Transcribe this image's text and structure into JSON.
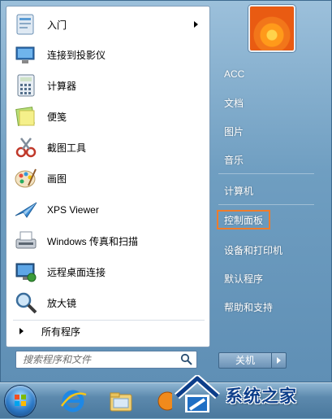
{
  "programs": [
    {
      "label": "入门",
      "icon": "getting-started-icon",
      "has_submenu": true
    },
    {
      "label": "连接到投影仪",
      "icon": "projector-icon",
      "has_submenu": false
    },
    {
      "label": "计算器",
      "icon": "calculator-icon",
      "has_submenu": false
    },
    {
      "label": "便笺",
      "icon": "sticky-notes-icon",
      "has_submenu": false
    },
    {
      "label": "截图工具",
      "icon": "snipping-tool-icon",
      "has_submenu": false
    },
    {
      "label": "画图",
      "icon": "paint-icon",
      "has_submenu": false
    },
    {
      "label": "XPS Viewer",
      "icon": "xps-viewer-icon",
      "has_submenu": false
    },
    {
      "label": "Windows 传真和扫描",
      "icon": "fax-scan-icon",
      "has_submenu": false
    },
    {
      "label": "远程桌面连接",
      "icon": "remote-desktop-icon",
      "has_submenu": false
    },
    {
      "label": "放大镜",
      "icon": "magnifier-icon",
      "has_submenu": false
    }
  ],
  "all_programs": "所有程序",
  "search": {
    "placeholder": "搜索程序和文件"
  },
  "right_items": [
    {
      "label": "ACC"
    },
    {
      "label": "文档"
    },
    {
      "label": "图片"
    },
    {
      "label": "音乐"
    },
    {
      "label": "计算机"
    },
    {
      "label": "控制面板",
      "highlighted": true
    },
    {
      "label": "设备和打印机"
    },
    {
      "label": "默认程序"
    },
    {
      "label": "帮助和支持"
    }
  ],
  "shutdown_label": "关机",
  "watermark_text": "系统之家",
  "colors": {
    "highlight_border": "#ef7c2b",
    "watermark_text": "#0d3e8a"
  }
}
